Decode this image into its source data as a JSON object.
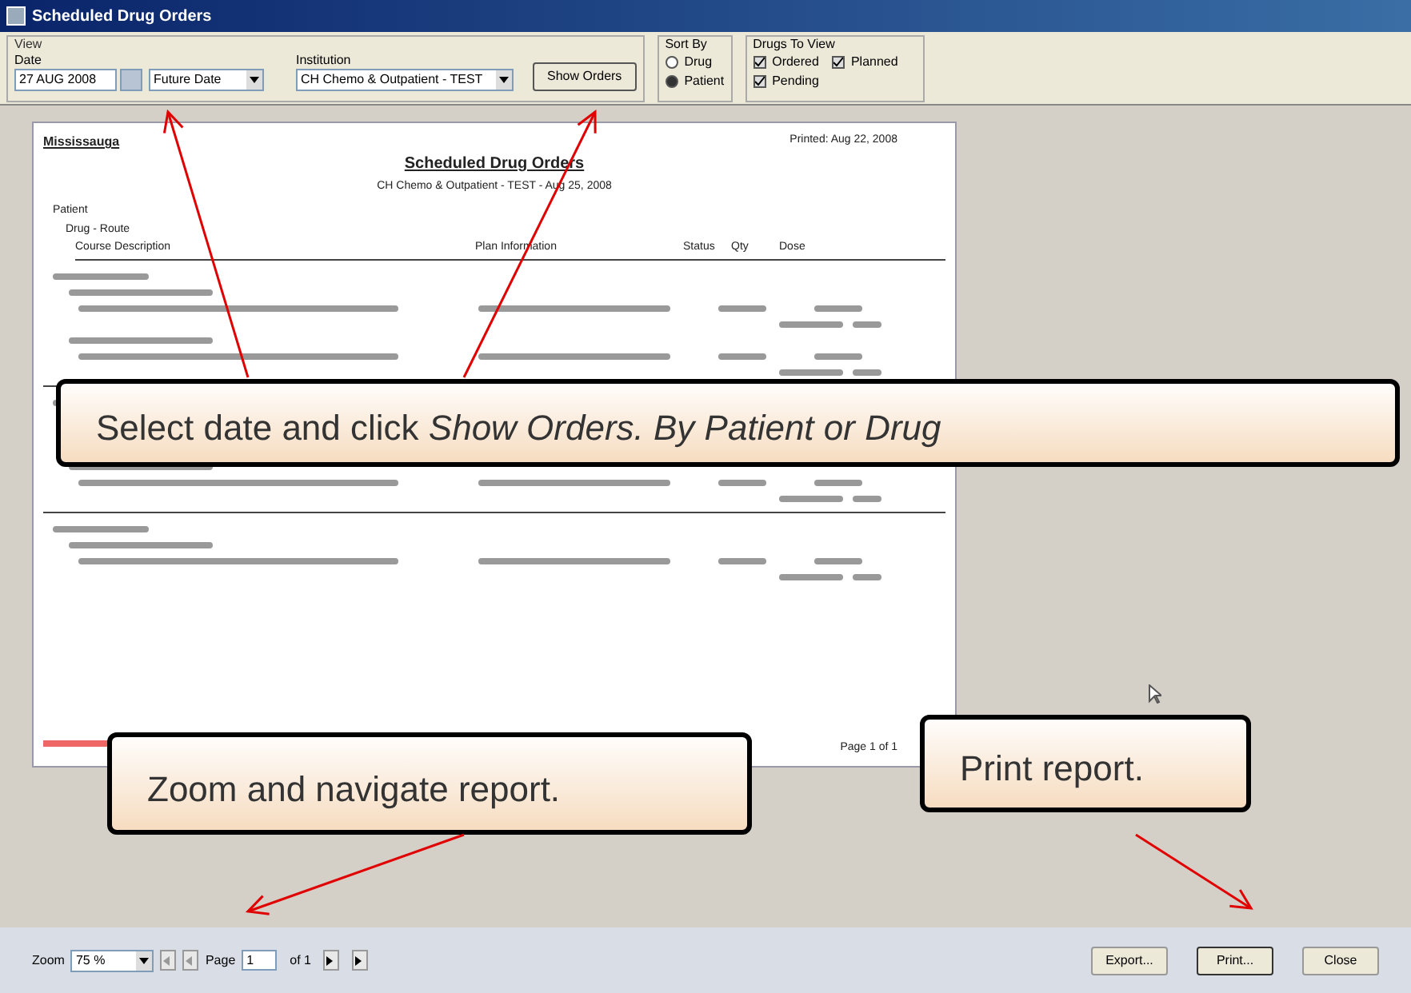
{
  "window": {
    "title": "Scheduled Drug Orders"
  },
  "toolbar": {
    "view_label": "View",
    "date_label": "Date",
    "date": "27 AUG 2008",
    "date_range": "Future Date",
    "institution_label": "Institution",
    "institution": "CH Chemo & Outpatient - TEST",
    "show_button": "Show Orders",
    "sort_by": {
      "label": "Sort By",
      "options": [
        {
          "label": "Drug",
          "selected": false
        },
        {
          "label": "Patient",
          "selected": true
        }
      ]
    },
    "drugs_to_view": {
      "label": "Drugs To View",
      "options": [
        {
          "label": "Ordered",
          "checked": true
        },
        {
          "label": "Planned",
          "checked": true
        },
        {
          "label": "Pending",
          "checked": true
        }
      ]
    }
  },
  "report": {
    "site": "Mississauga",
    "printed": "Printed: Aug 22, 2008",
    "title": "Scheduled Drug Orders",
    "subtitle": "CH Chemo & Outpatient - TEST - Aug 25, 2008",
    "group_label": "Patient",
    "subgroup_label": "Drug - Route",
    "columns": [
      "Course Description",
      "Plan Information",
      "Status",
      "Qty",
      "Dose"
    ],
    "footer": "Page 1 of 1"
  },
  "callouts": [
    {
      "text": "Select date and click *Show Orders. By Patient or Drug*"
    },
    {
      "text": "Zoom and navigate report."
    },
    {
      "text": "Print report."
    }
  ],
  "bottom_bar": {
    "zoom_label": "Zoom",
    "zoom": "75 %",
    "page_label": "Page",
    "page": "1",
    "page_count": "of 1",
    "buttons": [
      "Export...",
      "Print...",
      "Close"
    ]
  }
}
